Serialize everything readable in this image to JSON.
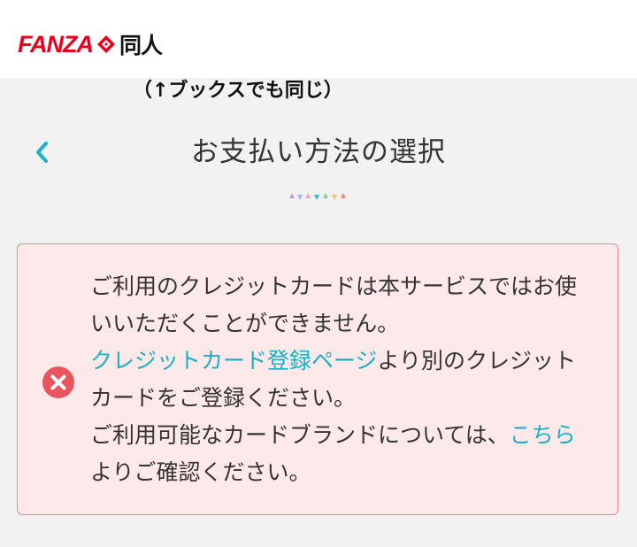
{
  "header": {
    "logo_brand": "FANZA",
    "logo_section": "同人"
  },
  "annotation": "（↑ブックスでも同じ）",
  "page": {
    "title": "お支払い方法の選択"
  },
  "alert": {
    "line1": "ご利用のクレジットカードは本サービスではお使いいただくことができません。",
    "link_register": "クレジットカード登録ページ",
    "line2_after": "より別のクレジットカードをご登録ください。",
    "line3_before": "ご利用可能なカードブランドについては、",
    "link_here": "こちら",
    "line3_after": "よりご確認ください。"
  },
  "colors": {
    "accent": "#1bb0c4",
    "brand_red": "#e8001c",
    "alert_bg": "#fde9ea",
    "alert_border": "#e58a94",
    "error_icon": "#e8555f"
  },
  "icons": [
    "chevron-left-icon",
    "error-x-icon",
    "logo-mark-icon",
    "decorative-triangles"
  ]
}
